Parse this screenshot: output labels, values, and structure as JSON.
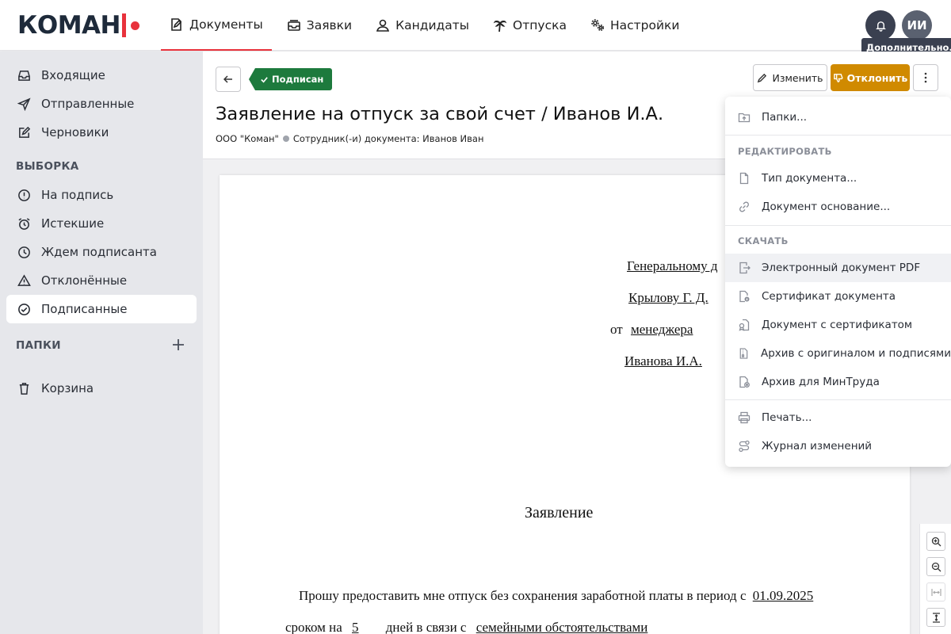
{
  "brand": {
    "logo_text": "КОМАН",
    "accent": "#e8323c"
  },
  "nav": [
    {
      "label": "Документы",
      "icon": "document-edit-icon",
      "active": true
    },
    {
      "label": "Заявки",
      "icon": "inbox-stack-icon"
    },
    {
      "label": "Кандидаты",
      "icon": "person-search-icon"
    },
    {
      "label": "Отпуска",
      "icon": "palm-tree-icon"
    },
    {
      "label": "Настройки",
      "icon": "gears-icon"
    }
  ],
  "user": {
    "initials": "ИИ",
    "tooltip": "Дополнительно..."
  },
  "sidebar": {
    "items": [
      {
        "label": "Входящие",
        "icon": "inbox-icon"
      },
      {
        "label": "Отправленные",
        "icon": "send-icon"
      },
      {
        "label": "Черновики",
        "icon": "draft-edit-icon"
      }
    ],
    "filter_heading": "ВЫБОРКА",
    "filters": [
      {
        "label": "На подпись",
        "icon": "alert-circle-icon"
      },
      {
        "label": "Истекшие",
        "icon": "alarm-clock-icon"
      },
      {
        "label": "Ждем подписанта",
        "icon": "clock-icon"
      },
      {
        "label": "Отклонённые",
        "icon": "warning-triangle-icon"
      },
      {
        "label": "Подписанные",
        "icon": "check-circle-icon",
        "active": true
      }
    ],
    "folders_heading": "ПАПКИ",
    "trash": {
      "label": "Корзина",
      "icon": "trash-icon"
    }
  },
  "document": {
    "status": "Подписан",
    "status_color": "#1d7a3d",
    "title": "Заявление на отпуск за свой счет / Иванов И.А.",
    "company": "ООО \"Коман\"",
    "employees": "Сотрудник(-и) документа: Иванов Иван",
    "edit_label": "Изменить",
    "reject_label": "Отклонить",
    "reject_color": "#d08a00"
  },
  "paper": {
    "addressee_pos": "Генеральному д",
    "addressee_name": "Крылову Г. Д.",
    "from_prefix": "от",
    "from_pos": "менеджера",
    "from_name": "Иванова И.А.",
    "heading": "Заявление",
    "body_line1_prefix": "Прошу предоставить мне отпуск без сохранения заработной платы в период с",
    "body_date": "01.09.2025",
    "body_line2_prefix": "сроком на",
    "body_days": "5",
    "body_line2_mid": "дней в связи с",
    "body_reason": "семейными обстоятельствами"
  },
  "menu": {
    "folders": "Папки...",
    "edit_heading": "РЕДАКТИРОВАТЬ",
    "doc_type": "Тип документа...",
    "base_doc": "Документ основание...",
    "download_heading": "СКАЧАТЬ",
    "pdf": "Электронный документ PDF",
    "certificate": "Сертификат документа",
    "doc_with_cert": "Документ с сертификатом",
    "archive_signatures": "Архив с оригиналом и подписями",
    "archive_mintrud": "Архив для МинТруда",
    "print": "Печать...",
    "changelog": "Журнал изменений"
  }
}
